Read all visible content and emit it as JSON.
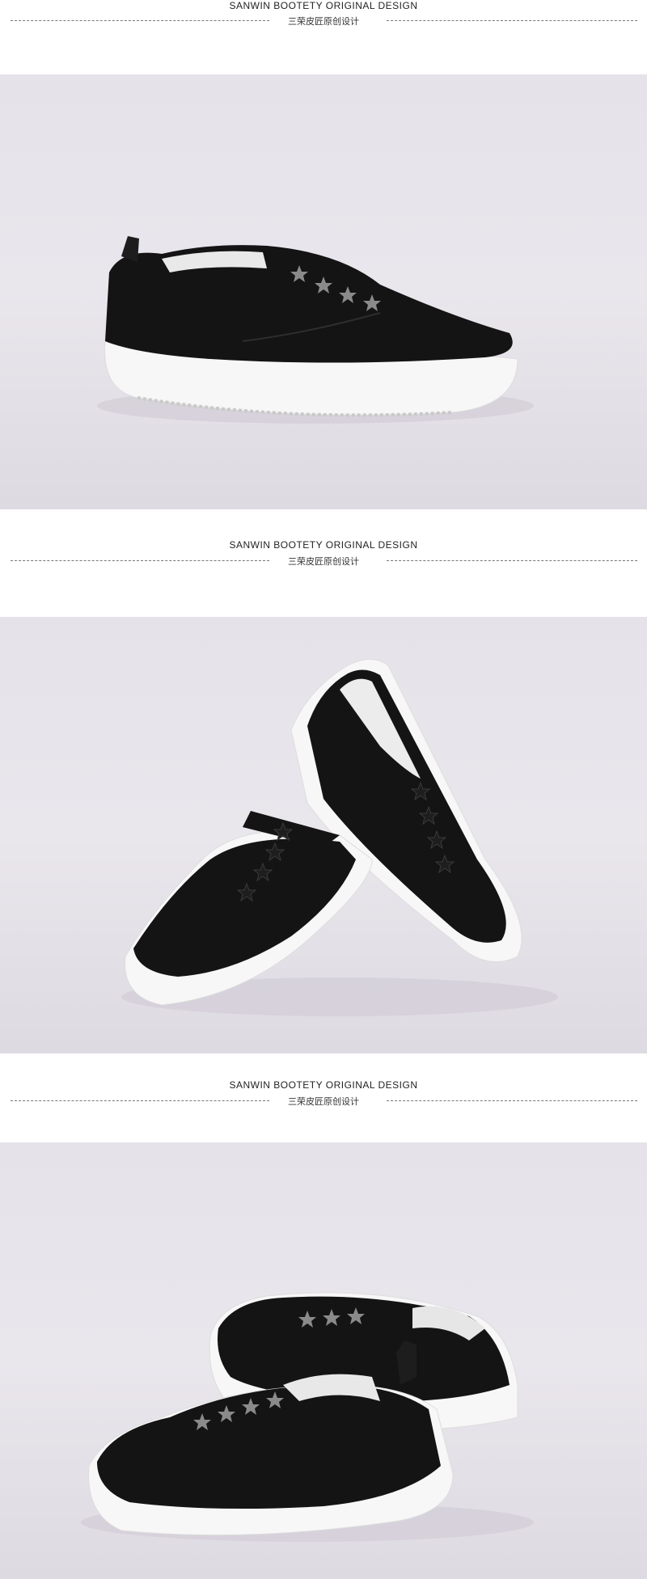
{
  "sections": [
    {
      "title_en": "SANWIN BOOTETY ORIGINAL DESIGN",
      "title_cn": "三荣皮匠原创设计"
    },
    {
      "title_en": "SANWIN BOOTETY ORIGINAL DESIGN",
      "title_cn": "三荣皮匠原创设计"
    },
    {
      "title_en": "SANWIN BOOTETY ORIGINAL DESIGN",
      "title_cn": "三荣皮匠原创设计"
    }
  ],
  "photos": [
    {
      "subject": "black-leather-slip-on-sneaker-side-view"
    },
    {
      "subject": "pair-black-leather-slip-on-sneakers-front-view"
    },
    {
      "subject": "pair-black-leather-slip-on-sneakers-rear-view"
    }
  ],
  "colors": {
    "backdrop": "#e7e3ea",
    "leather": "#141414",
    "sole": "#f7f7f7",
    "rule": "#777777"
  }
}
